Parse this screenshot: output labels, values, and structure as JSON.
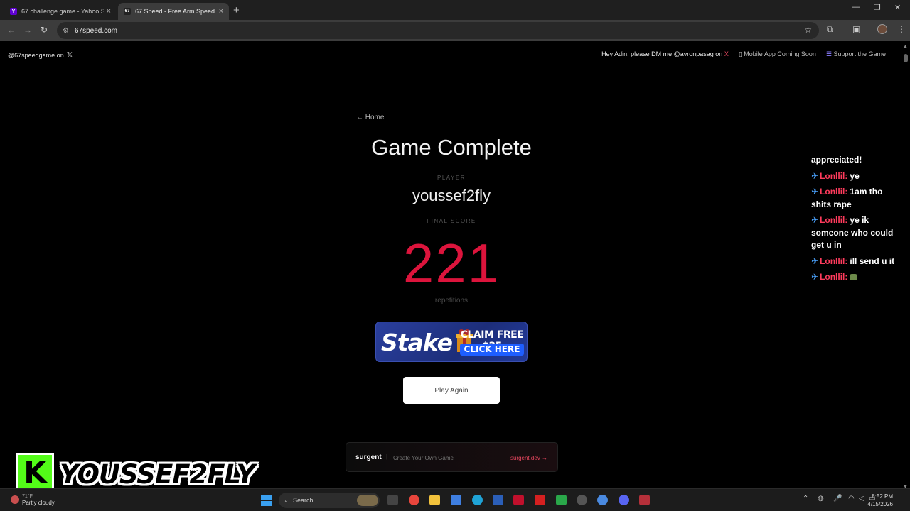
{
  "browser": {
    "tabs": [
      {
        "title": "67 challenge game - Yahoo Search",
        "favicon": "Y"
      },
      {
        "title": "67 Speed - Free Arm Speed Challenge",
        "favicon": "67"
      }
    ],
    "url": "67speed.com"
  },
  "topbar": {
    "x_handle": "@67speedgame on",
    "dm_note": "Hey Adin, please DM me @avronpasag on",
    "dm_x": "X",
    "mobile_app": "Mobile App Coming Soon",
    "support": "Support the Game"
  },
  "game": {
    "home_link": "← Home",
    "title": "Game Complete",
    "player_label": "PLAYER",
    "player_name": "youssef2fly",
    "score_label": "FINAL SCORE",
    "score": "221",
    "score_unit": "repetitions",
    "play_again": "Play Again"
  },
  "ad": {
    "brand": "Stake",
    "claim": "CLAIM FREE $35",
    "cta": "CLICK HERE"
  },
  "footer_banner": {
    "name": "surgent",
    "separator": "|",
    "tagline": "Create Your Own Game",
    "link": "surgent.dev →"
  },
  "chat": {
    "first_line": "appreciated!",
    "messages": [
      {
        "user": "Lonllil:",
        "text": "ye"
      },
      {
        "user": "Lonllil:",
        "text": "1am tho shits rape"
      },
      {
        "user": "Lonllil:",
        "text": "ye ik someone who could get u in"
      },
      {
        "user": "Lonllil:",
        "text": "ill send u it"
      },
      {
        "user": "Lonllil:",
        "text": ""
      }
    ]
  },
  "streamer": {
    "platform_letter": "K",
    "name": "YOUSSEF2FLY"
  },
  "taskbar": {
    "weather_temp": "71°F",
    "weather_desc": "Partly cloudy",
    "search": "Search",
    "time": "8:52 PM",
    "date": "4/15/2026"
  },
  "colors": {
    "score": "#dc143c",
    "kick_green": "#53fc18",
    "chat_user": "#ff3b5c",
    "stake_blue": "#1e5eff"
  }
}
